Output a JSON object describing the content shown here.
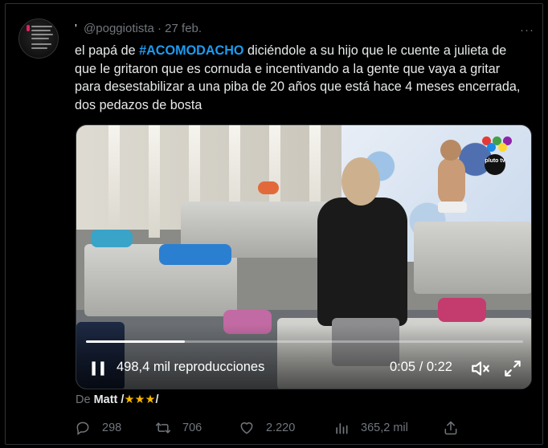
{
  "author": {
    "name_glyph": "'",
    "handle": "@poggiotista",
    "separator": "·",
    "date": "27 feb."
  },
  "menu_label": "···",
  "tweet": {
    "text_before": "el papá de ",
    "hashtag": "#ACOMODACHO",
    "text_after": " diciéndole a su hijo que le cuente a julieta de que le gritaron que es cornuda e incentivando a la gente que vaya a gritar para desestabilizar a una piba de 20 años que está hace 4 meses encerrada, dos pedazos de bosta"
  },
  "video": {
    "views": "498,4 mil reproducciones",
    "time": "0:05 / 0:22",
    "progress_fraction": 0.227,
    "channel_logo_text": "pluto tv",
    "icons": [
      "pause-icon",
      "mute-icon",
      "fullscreen-icon"
    ]
  },
  "attribution": {
    "prefix": "De",
    "name": "Matt",
    "slash1": "/",
    "stars": "★★★",
    "slash2": "/"
  },
  "actions": {
    "replies": "298",
    "retweets": "706",
    "likes": "2.220",
    "views": "365,2 mil"
  },
  "colors": {
    "background": "#000000",
    "text": "#e7e9ea",
    "muted": "#71767b",
    "hashtag": "#1d9bf0",
    "border": "#2f3336",
    "star": "#f4b400"
  }
}
